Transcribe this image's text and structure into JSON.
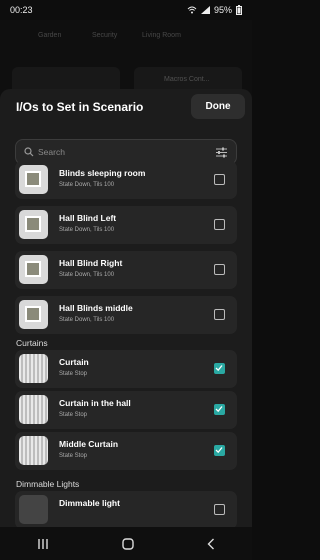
{
  "status_bar": {
    "time": "00:23",
    "battery": "95%"
  },
  "background": {
    "tabs": [
      "Garden",
      "Security",
      "Living Room"
    ],
    "card_label": "Macros Cont..."
  },
  "sheet": {
    "title": "I/Os to Set in Scenario",
    "done_label": "Done"
  },
  "search": {
    "placeholder": "Search"
  },
  "blinds": [
    {
      "name": "Blinds sleeping room",
      "state": "State Down, Tils 100",
      "checked": false
    },
    {
      "name": "Hall Blind Left",
      "state": "State Down, Tils 100",
      "checked": false
    },
    {
      "name": "Hall Blind Right",
      "state": "State Down, Tils 100",
      "checked": false
    },
    {
      "name": "Hall Blinds middle",
      "state": "State Down, Tils 100",
      "checked": false
    }
  ],
  "curtains_section": "Curtains",
  "curtains": [
    {
      "name": "Curtain",
      "state": "State Stop",
      "checked": true
    },
    {
      "name": "Curtain in the hall",
      "state": "State Stop",
      "checked": true
    },
    {
      "name": "Middle Curtain",
      "state": "State Stop",
      "checked": true
    }
  ],
  "dimmable_section": "Dimmable Lights",
  "dimmable": [
    {
      "name": "Dimmable light",
      "state": "",
      "checked": false
    }
  ],
  "colors": {
    "accent": "#2aa9a3",
    "sheet": "#1c1c1c",
    "row": "#262626"
  }
}
